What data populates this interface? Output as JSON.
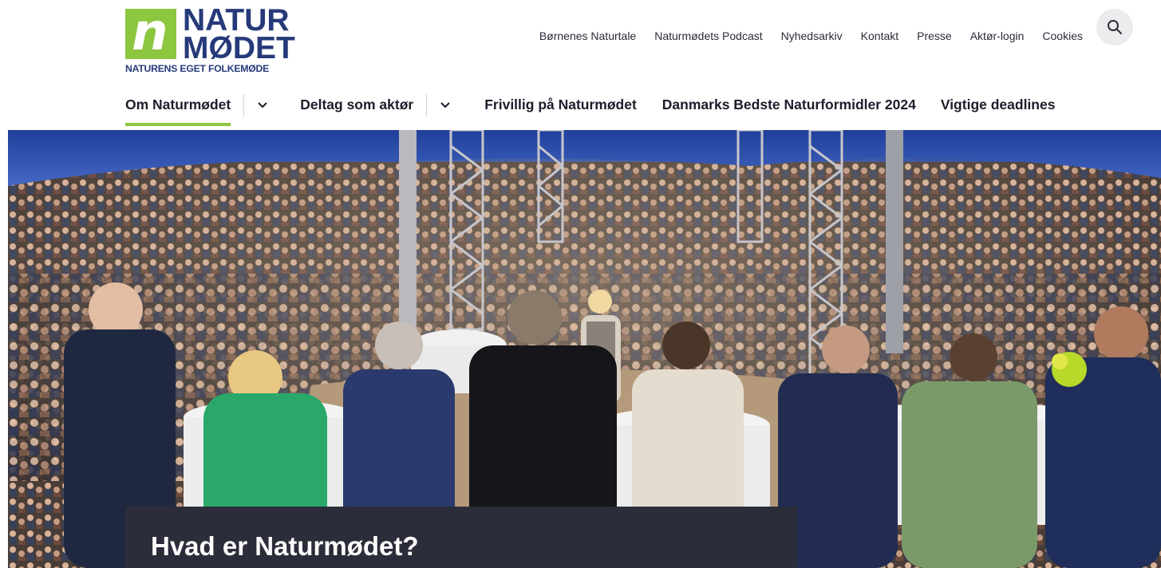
{
  "logo": {
    "mark": "n",
    "line1": "NATUR",
    "line2": "MØDET",
    "tagline": "NATURENS EGET FOLKEMØDE"
  },
  "top_links": [
    {
      "label": "Børnenes Naturtale"
    },
    {
      "label": "Naturmødets Podcast"
    },
    {
      "label": "Nyhedsarkiv"
    },
    {
      "label": "Kontakt"
    },
    {
      "label": "Presse"
    },
    {
      "label": "Aktør-login"
    },
    {
      "label": "Cookies"
    }
  ],
  "search": {
    "icon": "search-icon"
  },
  "main_nav": {
    "items": [
      {
        "label": "Om Naturmødet",
        "active": true,
        "has_dropdown": true
      },
      {
        "label": "Deltag som aktør",
        "active": false,
        "has_dropdown": true
      },
      {
        "label": "Frivillig på Naturmødet",
        "active": false,
        "has_dropdown": false
      },
      {
        "label": "Danmarks Bedste Naturformidler 2024",
        "active": false,
        "has_dropdown": false
      },
      {
        "label": "Vigtige deadlines",
        "active": false,
        "has_dropdown": false
      }
    ]
  },
  "hero": {
    "title": "Hvad er Naturmødet?",
    "image": "crowd-in-tent-photo"
  },
  "colors": {
    "brand_green": "#8dc63f",
    "brand_navy": "#263a7a",
    "card_dark": "#2c2d3a",
    "text_dark": "#1d1d2b"
  }
}
